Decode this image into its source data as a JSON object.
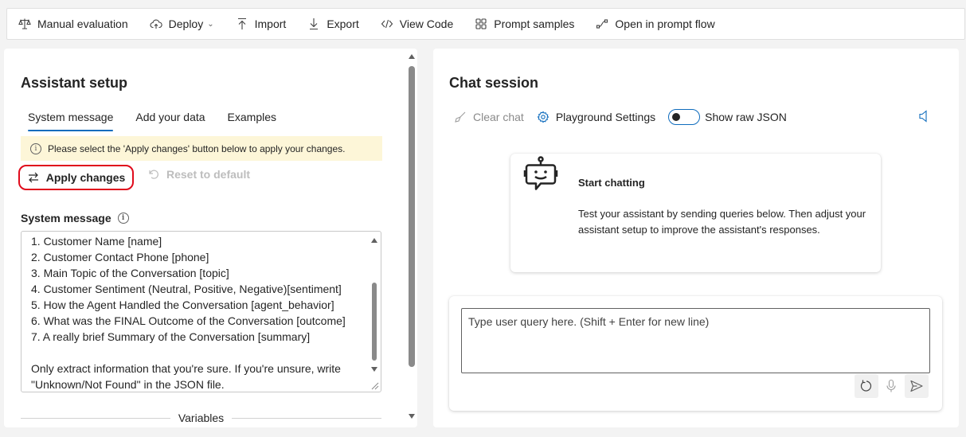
{
  "toolbar": {
    "items": [
      {
        "label": "Manual evaluation",
        "icon": "scales-icon"
      },
      {
        "label": "Deploy",
        "icon": "cloud-upload-icon",
        "has_dropdown": true
      },
      {
        "label": "Import",
        "icon": "arrow-up-icon"
      },
      {
        "label": "Export",
        "icon": "arrow-down-icon"
      },
      {
        "label": "View Code",
        "icon": "code-icon"
      },
      {
        "label": "Prompt samples",
        "icon": "grid-icon"
      },
      {
        "label": "Open in prompt flow",
        "icon": "flow-icon"
      }
    ]
  },
  "assistant_setup": {
    "title": "Assistant setup",
    "tabs": [
      "System message",
      "Add your data",
      "Examples"
    ],
    "active_tab": "System message",
    "notice": "Please select the 'Apply changes' button below to apply your changes.",
    "apply_label": "Apply changes",
    "reset_label": "Reset to default",
    "system_message_label": "System message",
    "system_message_lines": [
      "1. Customer Name [name]",
      "2. Customer Contact Phone [phone]",
      "3. Main Topic of the Conversation [topic]",
      "4. Customer Sentiment (Neutral, Positive, Negative)[sentiment]",
      "5. How the Agent Handled the Conversation [agent_behavior]",
      "6. What was the FINAL Outcome of the Conversation [outcome]",
      "7. A really brief Summary of the Conversation [summary]",
      "",
      "Only extract information that you're sure. If you're unsure, write",
      "\"Unknown/Not Found\" in the JSON file."
    ],
    "variables_label": "Variables"
  },
  "chat_session": {
    "title": "Chat session",
    "clear_chat_label": "Clear chat",
    "playground_settings_label": "Playground Settings",
    "show_raw_json_label": "Show raw JSON",
    "show_raw_json_on": false,
    "start_title": "Start chatting",
    "start_description": "Test your assistant by sending queries below. Then adjust your assistant setup to improve the assistant's responses.",
    "input_placeholder": "Type user query here. (Shift + Enter for new line)"
  },
  "colors": {
    "accent": "#0f6cbd",
    "highlight_ring": "#e00b1c",
    "notice_bg": "#fdf6d8"
  }
}
